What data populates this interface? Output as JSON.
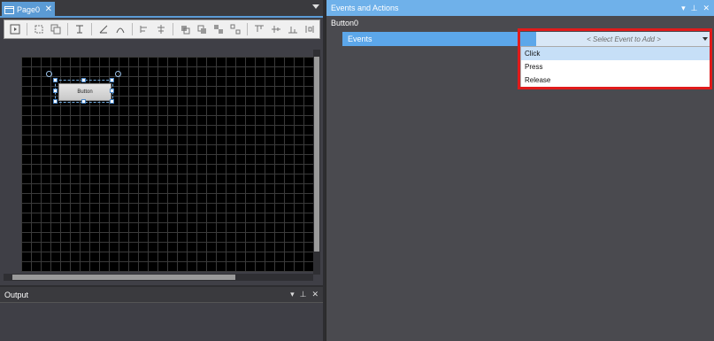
{
  "editor": {
    "tab_label": "Page0",
    "close_glyph": "✕",
    "canvas_button_label": "Button"
  },
  "output": {
    "title": "Output",
    "ctrl_dropdown": "▾",
    "ctrl_pin": "⊥",
    "ctrl_close": "✕"
  },
  "events_panel": {
    "title": "Events and Actions",
    "ctrl_dropdown": "▾",
    "ctrl_pin": "⊥",
    "ctrl_close": "✕",
    "object_name": "Button0",
    "events_label": "Events",
    "select_placeholder": "< Select Event to Add >",
    "options": [
      "Click",
      "Press",
      "Release"
    ],
    "selected_option": "Click"
  },
  "colors": {
    "accent": "#5ca7ea",
    "highlight": "#e01b1b"
  }
}
